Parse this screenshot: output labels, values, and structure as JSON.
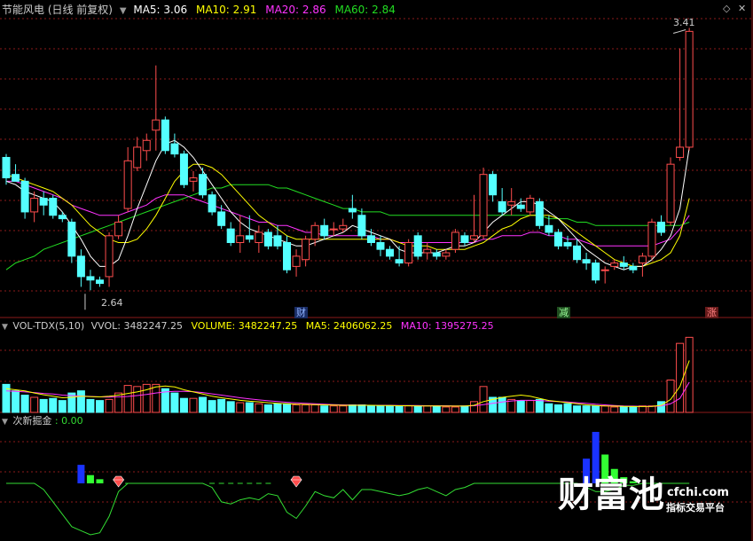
{
  "colors": {
    "up": "#ff4d4d",
    "down": "#54ffff",
    "ma5": "#ffffff",
    "ma10": "#ffff00",
    "ma20": "#ff33ff",
    "ma60": "#22dd22",
    "grid": "#8b1a1a",
    "label": "#cccccc",
    "indicator": "#33dd33",
    "blue_bar": "#1a33ff",
    "green_bar": "#33ff33",
    "gem": "#ff4d4d"
  },
  "header": {
    "title": "节能风电 (日线 前复权)",
    "ma5": "MA5: 3.06",
    "ma10": "MA10: 2.91",
    "ma20": "MA20: 2.86",
    "ma60": "MA60: 2.84"
  },
  "price_panel": {
    "high_label": "3.41",
    "low_label": "2.64",
    "event_tags": [
      "财",
      "减",
      "涨"
    ]
  },
  "volume_panel": {
    "indicator": "VOL-TDX(5,10)",
    "vvol": "VVOL: 3482247.25",
    "volume": "VOLUME: 3482247.25",
    "ma5": "MA5: 2406062.25",
    "ma10": "MA10: 1395275.25"
  },
  "indicator_panel": {
    "name": "次新掘金",
    "value": ": 0.00"
  },
  "watermark": {
    "brand": "财富池",
    "domain": "cfchi.com",
    "slogan": "指标交易平台"
  },
  "controls": {
    "settings_icon": "diamond-icon",
    "close_icon": "close-icon"
  },
  "chart_data": {
    "type": "candlestick",
    "price_range": [
      2.56,
      3.44
    ],
    "candles": [
      {
        "o": 3.03,
        "h": 3.04,
        "l": 2.95,
        "c": 2.97
      },
      {
        "o": 2.98,
        "h": 3.01,
        "l": 2.96,
        "c": 2.96
      },
      {
        "o": 2.96,
        "h": 2.97,
        "l": 2.85,
        "c": 2.87
      },
      {
        "o": 2.87,
        "h": 2.93,
        "l": 2.84,
        "c": 2.91
      },
      {
        "o": 2.91,
        "h": 2.93,
        "l": 2.86,
        "c": 2.89
      },
      {
        "o": 2.91,
        "h": 2.92,
        "l": 2.85,
        "c": 2.86
      },
      {
        "o": 2.86,
        "h": 2.87,
        "l": 2.84,
        "c": 2.85
      },
      {
        "o": 2.84,
        "h": 2.85,
        "l": 2.72,
        "c": 2.74
      },
      {
        "o": 2.74,
        "h": 2.76,
        "l": 2.65,
        "c": 2.68
      },
      {
        "o": 2.68,
        "h": 2.7,
        "l": 2.64,
        "c": 2.67
      },
      {
        "o": 2.67,
        "h": 2.68,
        "l": 2.65,
        "c": 2.66
      },
      {
        "o": 2.68,
        "h": 2.81,
        "l": 2.65,
        "c": 2.8
      },
      {
        "o": 2.8,
        "h": 2.86,
        "l": 2.79,
        "c": 2.84
      },
      {
        "o": 2.88,
        "h": 3.06,
        "l": 2.87,
        "c": 3.02
      },
      {
        "o": 3.0,
        "h": 3.09,
        "l": 2.99,
        "c": 3.06
      },
      {
        "o": 3.05,
        "h": 3.1,
        "l": 3.02,
        "c": 3.08
      },
      {
        "o": 3.11,
        "h": 3.3,
        "l": 3.05,
        "c": 3.14
      },
      {
        "o": 3.14,
        "h": 3.15,
        "l": 3.04,
        "c": 3.05
      },
      {
        "o": 3.07,
        "h": 3.1,
        "l": 3.03,
        "c": 3.04
      },
      {
        "o": 3.04,
        "h": 3.05,
        "l": 2.94,
        "c": 2.95
      },
      {
        "o": 2.96,
        "h": 2.99,
        "l": 2.93,
        "c": 2.97
      },
      {
        "o": 2.98,
        "h": 3.0,
        "l": 2.91,
        "c": 2.92
      },
      {
        "o": 2.92,
        "h": 2.93,
        "l": 2.86,
        "c": 2.87
      },
      {
        "o": 2.87,
        "h": 2.89,
        "l": 2.82,
        "c": 2.83
      },
      {
        "o": 2.82,
        "h": 2.84,
        "l": 2.77,
        "c": 2.78
      },
      {
        "o": 2.78,
        "h": 2.86,
        "l": 2.75,
        "c": 2.8
      },
      {
        "o": 2.8,
        "h": 2.86,
        "l": 2.78,
        "c": 2.79
      },
      {
        "o": 2.78,
        "h": 2.83,
        "l": 2.75,
        "c": 2.81
      },
      {
        "o": 2.81,
        "h": 2.82,
        "l": 2.76,
        "c": 2.77
      },
      {
        "o": 2.8,
        "h": 2.83,
        "l": 2.76,
        "c": 2.77
      },
      {
        "o": 2.78,
        "h": 2.8,
        "l": 2.69,
        "c": 2.7
      },
      {
        "o": 2.71,
        "h": 2.76,
        "l": 2.68,
        "c": 2.74
      },
      {
        "o": 2.73,
        "h": 2.8,
        "l": 2.71,
        "c": 2.79
      },
      {
        "o": 2.79,
        "h": 2.84,
        "l": 2.77,
        "c": 2.83
      },
      {
        "o": 2.83,
        "h": 2.85,
        "l": 2.79,
        "c": 2.8
      },
      {
        "o": 2.82,
        "h": 2.84,
        "l": 2.8,
        "c": 2.82
      },
      {
        "o": 2.82,
        "h": 2.85,
        "l": 2.81,
        "c": 2.83
      },
      {
        "o": 2.88,
        "h": 2.92,
        "l": 2.85,
        "c": 2.87
      },
      {
        "o": 2.86,
        "h": 2.88,
        "l": 2.79,
        "c": 2.8
      },
      {
        "o": 2.8,
        "h": 2.82,
        "l": 2.77,
        "c": 2.78
      },
      {
        "o": 2.78,
        "h": 2.8,
        "l": 2.74,
        "c": 2.76
      },
      {
        "o": 2.76,
        "h": 2.77,
        "l": 2.73,
        "c": 2.74
      },
      {
        "o": 2.73,
        "h": 2.77,
        "l": 2.71,
        "c": 2.72
      },
      {
        "o": 2.72,
        "h": 2.79,
        "l": 2.71,
        "c": 2.78
      },
      {
        "o": 2.8,
        "h": 2.81,
        "l": 2.73,
        "c": 2.74
      },
      {
        "o": 2.75,
        "h": 2.78,
        "l": 2.73,
        "c": 2.76
      },
      {
        "o": 2.75,
        "h": 2.76,
        "l": 2.73,
        "c": 2.74
      },
      {
        "o": 2.74,
        "h": 2.76,
        "l": 2.73,
        "c": 2.75
      },
      {
        "o": 2.76,
        "h": 2.82,
        "l": 2.75,
        "c": 2.81
      },
      {
        "o": 2.8,
        "h": 2.81,
        "l": 2.77,
        "c": 2.78
      },
      {
        "o": 2.79,
        "h": 2.92,
        "l": 2.78,
        "c": 2.8
      },
      {
        "o": 2.8,
        "h": 3.0,
        "l": 2.79,
        "c": 2.98
      },
      {
        "o": 2.98,
        "h": 2.99,
        "l": 2.9,
        "c": 2.92
      },
      {
        "o": 2.9,
        "h": 2.94,
        "l": 2.86,
        "c": 2.87
      },
      {
        "o": 2.89,
        "h": 2.94,
        "l": 2.86,
        "c": 2.9
      },
      {
        "o": 2.89,
        "h": 2.91,
        "l": 2.87,
        "c": 2.88
      },
      {
        "o": 2.87,
        "h": 2.92,
        "l": 2.86,
        "c": 2.91
      },
      {
        "o": 2.9,
        "h": 2.91,
        "l": 2.82,
        "c": 2.83
      },
      {
        "o": 2.83,
        "h": 2.86,
        "l": 2.8,
        "c": 2.81
      },
      {
        "o": 2.81,
        "h": 2.82,
        "l": 2.76,
        "c": 2.77
      },
      {
        "o": 2.78,
        "h": 2.8,
        "l": 2.76,
        "c": 2.77
      },
      {
        "o": 2.77,
        "h": 2.79,
        "l": 2.72,
        "c": 2.73
      },
      {
        "o": 2.73,
        "h": 2.75,
        "l": 2.7,
        "c": 2.72
      },
      {
        "o": 2.72,
        "h": 2.73,
        "l": 2.66,
        "c": 2.67
      },
      {
        "o": 2.7,
        "h": 2.71,
        "l": 2.66,
        "c": 2.7
      },
      {
        "o": 2.71,
        "h": 2.73,
        "l": 2.7,
        "c": 2.72
      },
      {
        "o": 2.72,
        "h": 2.74,
        "l": 2.7,
        "c": 2.71
      },
      {
        "o": 2.71,
        "h": 2.72,
        "l": 2.69,
        "c": 2.7
      },
      {
        "o": 2.72,
        "h": 2.75,
        "l": 2.68,
        "c": 2.74
      },
      {
        "o": 2.74,
        "h": 2.85,
        "l": 2.73,
        "c": 2.84
      },
      {
        "o": 2.84,
        "h": 2.86,
        "l": 2.8,
        "c": 2.81
      },
      {
        "o": 2.84,
        "h": 3.03,
        "l": 2.83,
        "c": 3.01
      },
      {
        "o": 3.03,
        "h": 3.35,
        "l": 3.02,
        "c": 3.06
      },
      {
        "o": 3.06,
        "h": 3.41,
        "l": 3.05,
        "c": 3.4
      }
    ],
    "ma5": [
      2.96,
      2.95,
      2.93,
      2.92,
      2.91,
      2.9,
      2.87,
      2.83,
      2.79,
      2.74,
      2.71,
      2.71,
      2.73,
      2.8,
      2.88,
      2.95,
      3.02,
      3.07,
      3.08,
      3.06,
      3.03,
      2.99,
      2.95,
      2.91,
      2.87,
      2.84,
      2.82,
      2.81,
      2.8,
      2.79,
      2.78,
      2.77,
      2.77,
      2.78,
      2.79,
      2.8,
      2.81,
      2.83,
      2.82,
      2.81,
      2.8,
      2.79,
      2.76,
      2.75,
      2.75,
      2.75,
      2.75,
      2.76,
      2.77,
      2.77,
      2.78,
      2.81,
      2.84,
      2.86,
      2.88,
      2.9,
      2.9,
      2.89,
      2.87,
      2.85,
      2.82,
      2.79,
      2.76,
      2.74,
      2.72,
      2.71,
      2.7,
      2.71,
      2.71,
      2.73,
      2.76,
      2.8,
      2.88,
      3.06
    ],
    "ma10": [
      2.98,
      2.97,
      2.96,
      2.95,
      2.94,
      2.93,
      2.91,
      2.89,
      2.86,
      2.83,
      2.81,
      2.79,
      2.78,
      2.78,
      2.79,
      2.82,
      2.86,
      2.91,
      2.96,
      2.99,
      3.01,
      3.01,
      3.0,
      2.98,
      2.95,
      2.92,
      2.89,
      2.86,
      2.84,
      2.82,
      2.8,
      2.79,
      2.79,
      2.79,
      2.79,
      2.79,
      2.79,
      2.79,
      2.79,
      2.79,
      2.79,
      2.79,
      2.78,
      2.77,
      2.77,
      2.77,
      2.76,
      2.76,
      2.76,
      2.76,
      2.77,
      2.78,
      2.8,
      2.82,
      2.83,
      2.85,
      2.86,
      2.86,
      2.86,
      2.85,
      2.83,
      2.81,
      2.79,
      2.77,
      2.75,
      2.73,
      2.72,
      2.71,
      2.71,
      2.72,
      2.73,
      2.75,
      2.8,
      2.91
    ],
    "ma20": [
      2.96,
      2.96,
      2.95,
      2.94,
      2.93,
      2.92,
      2.91,
      2.89,
      2.88,
      2.87,
      2.86,
      2.86,
      2.86,
      2.87,
      2.88,
      2.89,
      2.91,
      2.92,
      2.92,
      2.92,
      2.91,
      2.9,
      2.89,
      2.88,
      2.87,
      2.86,
      2.85,
      2.84,
      2.84,
      2.83,
      2.83,
      2.82,
      2.81,
      2.81,
      2.8,
      2.8,
      2.8,
      2.8,
      2.8,
      2.8,
      2.79,
      2.79,
      2.78,
      2.78,
      2.78,
      2.78,
      2.78,
      2.78,
      2.78,
      2.78,
      2.78,
      2.79,
      2.79,
      2.8,
      2.8,
      2.8,
      2.81,
      2.81,
      2.8,
      2.8,
      2.79,
      2.79,
      2.78,
      2.77,
      2.77,
      2.77,
      2.77,
      2.77,
      2.77,
      2.77,
      2.78,
      2.79,
      2.82,
      2.86
    ],
    "ma60": [
      2.7,
      2.72,
      2.73,
      2.74,
      2.76,
      2.77,
      2.78,
      2.79,
      2.8,
      2.81,
      2.82,
      2.83,
      2.84,
      2.85,
      2.86,
      2.87,
      2.88,
      2.89,
      2.9,
      2.91,
      2.92,
      2.93,
      2.94,
      2.94,
      2.95,
      2.95,
      2.95,
      2.95,
      2.95,
      2.94,
      2.94,
      2.93,
      2.92,
      2.91,
      2.9,
      2.89,
      2.88,
      2.88,
      2.87,
      2.87,
      2.87,
      2.86,
      2.86,
      2.86,
      2.86,
      2.86,
      2.86,
      2.86,
      2.86,
      2.86,
      2.86,
      2.86,
      2.86,
      2.86,
      2.86,
      2.86,
      2.86,
      2.86,
      2.85,
      2.85,
      2.85,
      2.84,
      2.84,
      2.83,
      2.83,
      2.83,
      2.83,
      2.83,
      2.83,
      2.83,
      2.83,
      2.83,
      2.83,
      2.84
    ],
    "volume": [
      1.3,
      1.0,
      0.8,
      0.7,
      0.6,
      0.65,
      0.55,
      0.9,
      1.0,
      0.6,
      0.55,
      0.6,
      0.9,
      1.25,
      1.2,
      1.3,
      1.3,
      1.1,
      0.9,
      0.65,
      0.65,
      0.7,
      0.55,
      0.6,
      0.5,
      0.45,
      0.45,
      0.4,
      0.35,
      0.4,
      0.4,
      0.35,
      0.35,
      0.35,
      0.3,
      0.3,
      0.3,
      0.35,
      0.35,
      0.3,
      0.3,
      0.3,
      0.3,
      0.3,
      0.3,
      0.3,
      0.3,
      0.25,
      0.25,
      0.3,
      0.5,
      1.2,
      0.7,
      0.7,
      0.6,
      0.55,
      0.55,
      0.6,
      0.4,
      0.35,
      0.4,
      0.3,
      0.3,
      0.3,
      0.3,
      0.25,
      0.25,
      0.25,
      0.3,
      0.3,
      0.5,
      1.5,
      3.2,
      3.48
    ],
    "volume_ma5": [
      1.1,
      1.05,
      1.0,
      0.9,
      0.82,
      0.75,
      0.68,
      0.7,
      0.75,
      0.73,
      0.72,
      0.75,
      0.8,
      0.88,
      0.95,
      1.05,
      1.18,
      1.22,
      1.18,
      1.05,
      0.95,
      0.85,
      0.75,
      0.68,
      0.62,
      0.56,
      0.52,
      0.49,
      0.45,
      0.42,
      0.4,
      0.38,
      0.37,
      0.36,
      0.35,
      0.34,
      0.33,
      0.33,
      0.33,
      0.33,
      0.32,
      0.32,
      0.31,
      0.31,
      0.3,
      0.3,
      0.3,
      0.29,
      0.29,
      0.29,
      0.33,
      0.5,
      0.6,
      0.7,
      0.75,
      0.8,
      0.75,
      0.65,
      0.55,
      0.5,
      0.45,
      0.4,
      0.35,
      0.32,
      0.3,
      0.29,
      0.28,
      0.27,
      0.27,
      0.28,
      0.33,
      0.6,
      1.2,
      2.41
    ],
    "volume_ma10": [
      1.0,
      0.98,
      0.95,
      0.92,
      0.88,
      0.85,
      0.8,
      0.78,
      0.76,
      0.74,
      0.72,
      0.71,
      0.72,
      0.74,
      0.78,
      0.83,
      0.9,
      0.95,
      0.98,
      0.98,
      0.96,
      0.92,
      0.86,
      0.8,
      0.74,
      0.68,
      0.63,
      0.58,
      0.54,
      0.5,
      0.47,
      0.44,
      0.42,
      0.4,
      0.38,
      0.36,
      0.35,
      0.34,
      0.34,
      0.33,
      0.33,
      0.33,
      0.32,
      0.32,
      0.32,
      0.31,
      0.31,
      0.31,
      0.3,
      0.3,
      0.31,
      0.36,
      0.42,
      0.48,
      0.53,
      0.56,
      0.56,
      0.55,
      0.52,
      0.5,
      0.48,
      0.45,
      0.42,
      0.38,
      0.35,
      0.32,
      0.3,
      0.29,
      0.28,
      0.28,
      0.3,
      0.4,
      0.65,
      1.4
    ],
    "volume_max": 3.7,
    "indicator_line": [
      0.0,
      0.0,
      0.0,
      0.0,
      -0.3,
      -0.9,
      -1.5,
      -2.1,
      -2.3,
      -2.5,
      -2.4,
      -1.6,
      -0.4,
      0.0,
      0.0,
      0.0,
      0.0,
      0.0,
      0.0,
      0.0,
      0.0,
      0.0,
      -0.2,
      -0.9,
      -1.0,
      -0.8,
      -0.7,
      -0.8,
      -0.5,
      -0.6,
      -1.4,
      -1.7,
      -1.1,
      -0.4,
      -0.6,
      -0.7,
      -0.3,
      -0.8,
      -0.3,
      -0.3,
      -0.4,
      -0.5,
      -0.6,
      -0.5,
      -0.3,
      -0.2,
      -0.4,
      -0.6,
      -0.3,
      -0.2,
      0.0,
      0.0,
      0.0,
      0.0,
      0.0,
      0.0,
      0.0,
      0.0,
      0.0,
      0.0,
      0.0,
      0.0,
      -0.2,
      -0.4,
      -0.4,
      -0.3,
      -0.1,
      -0.1,
      0.0,
      0.0,
      0.0,
      0.0,
      0.0,
      0.0
    ],
    "indicator_bars": [
      {
        "i": 8,
        "value": 0.9,
        "color": "blue"
      },
      {
        "i": 9,
        "value": 0.4,
        "color": "green"
      },
      {
        "i": 10,
        "value": 0.2,
        "color": "green"
      },
      {
        "i": 62,
        "value": 1.2,
        "color": "blue"
      },
      {
        "i": 63,
        "value": 2.5,
        "color": "blue"
      },
      {
        "i": 64,
        "value": 1.4,
        "color": "green"
      },
      {
        "i": 65,
        "value": 0.7,
        "color": "green"
      },
      {
        "i": 66,
        "value": 0.3,
        "color": "green"
      },
      {
        "i": 67,
        "value": 0.1,
        "color": "green"
      }
    ],
    "indicator_range": [
      -2.8,
      2.8
    ],
    "indicator_dashes": [
      13,
      14,
      22,
      23,
      24,
      25,
      26,
      27,
      28
    ],
    "indicator_gems": [
      12,
      31
    ],
    "tag_positions": [
      30,
      57,
      72
    ],
    "high_index": 73,
    "low_index": 9
  }
}
